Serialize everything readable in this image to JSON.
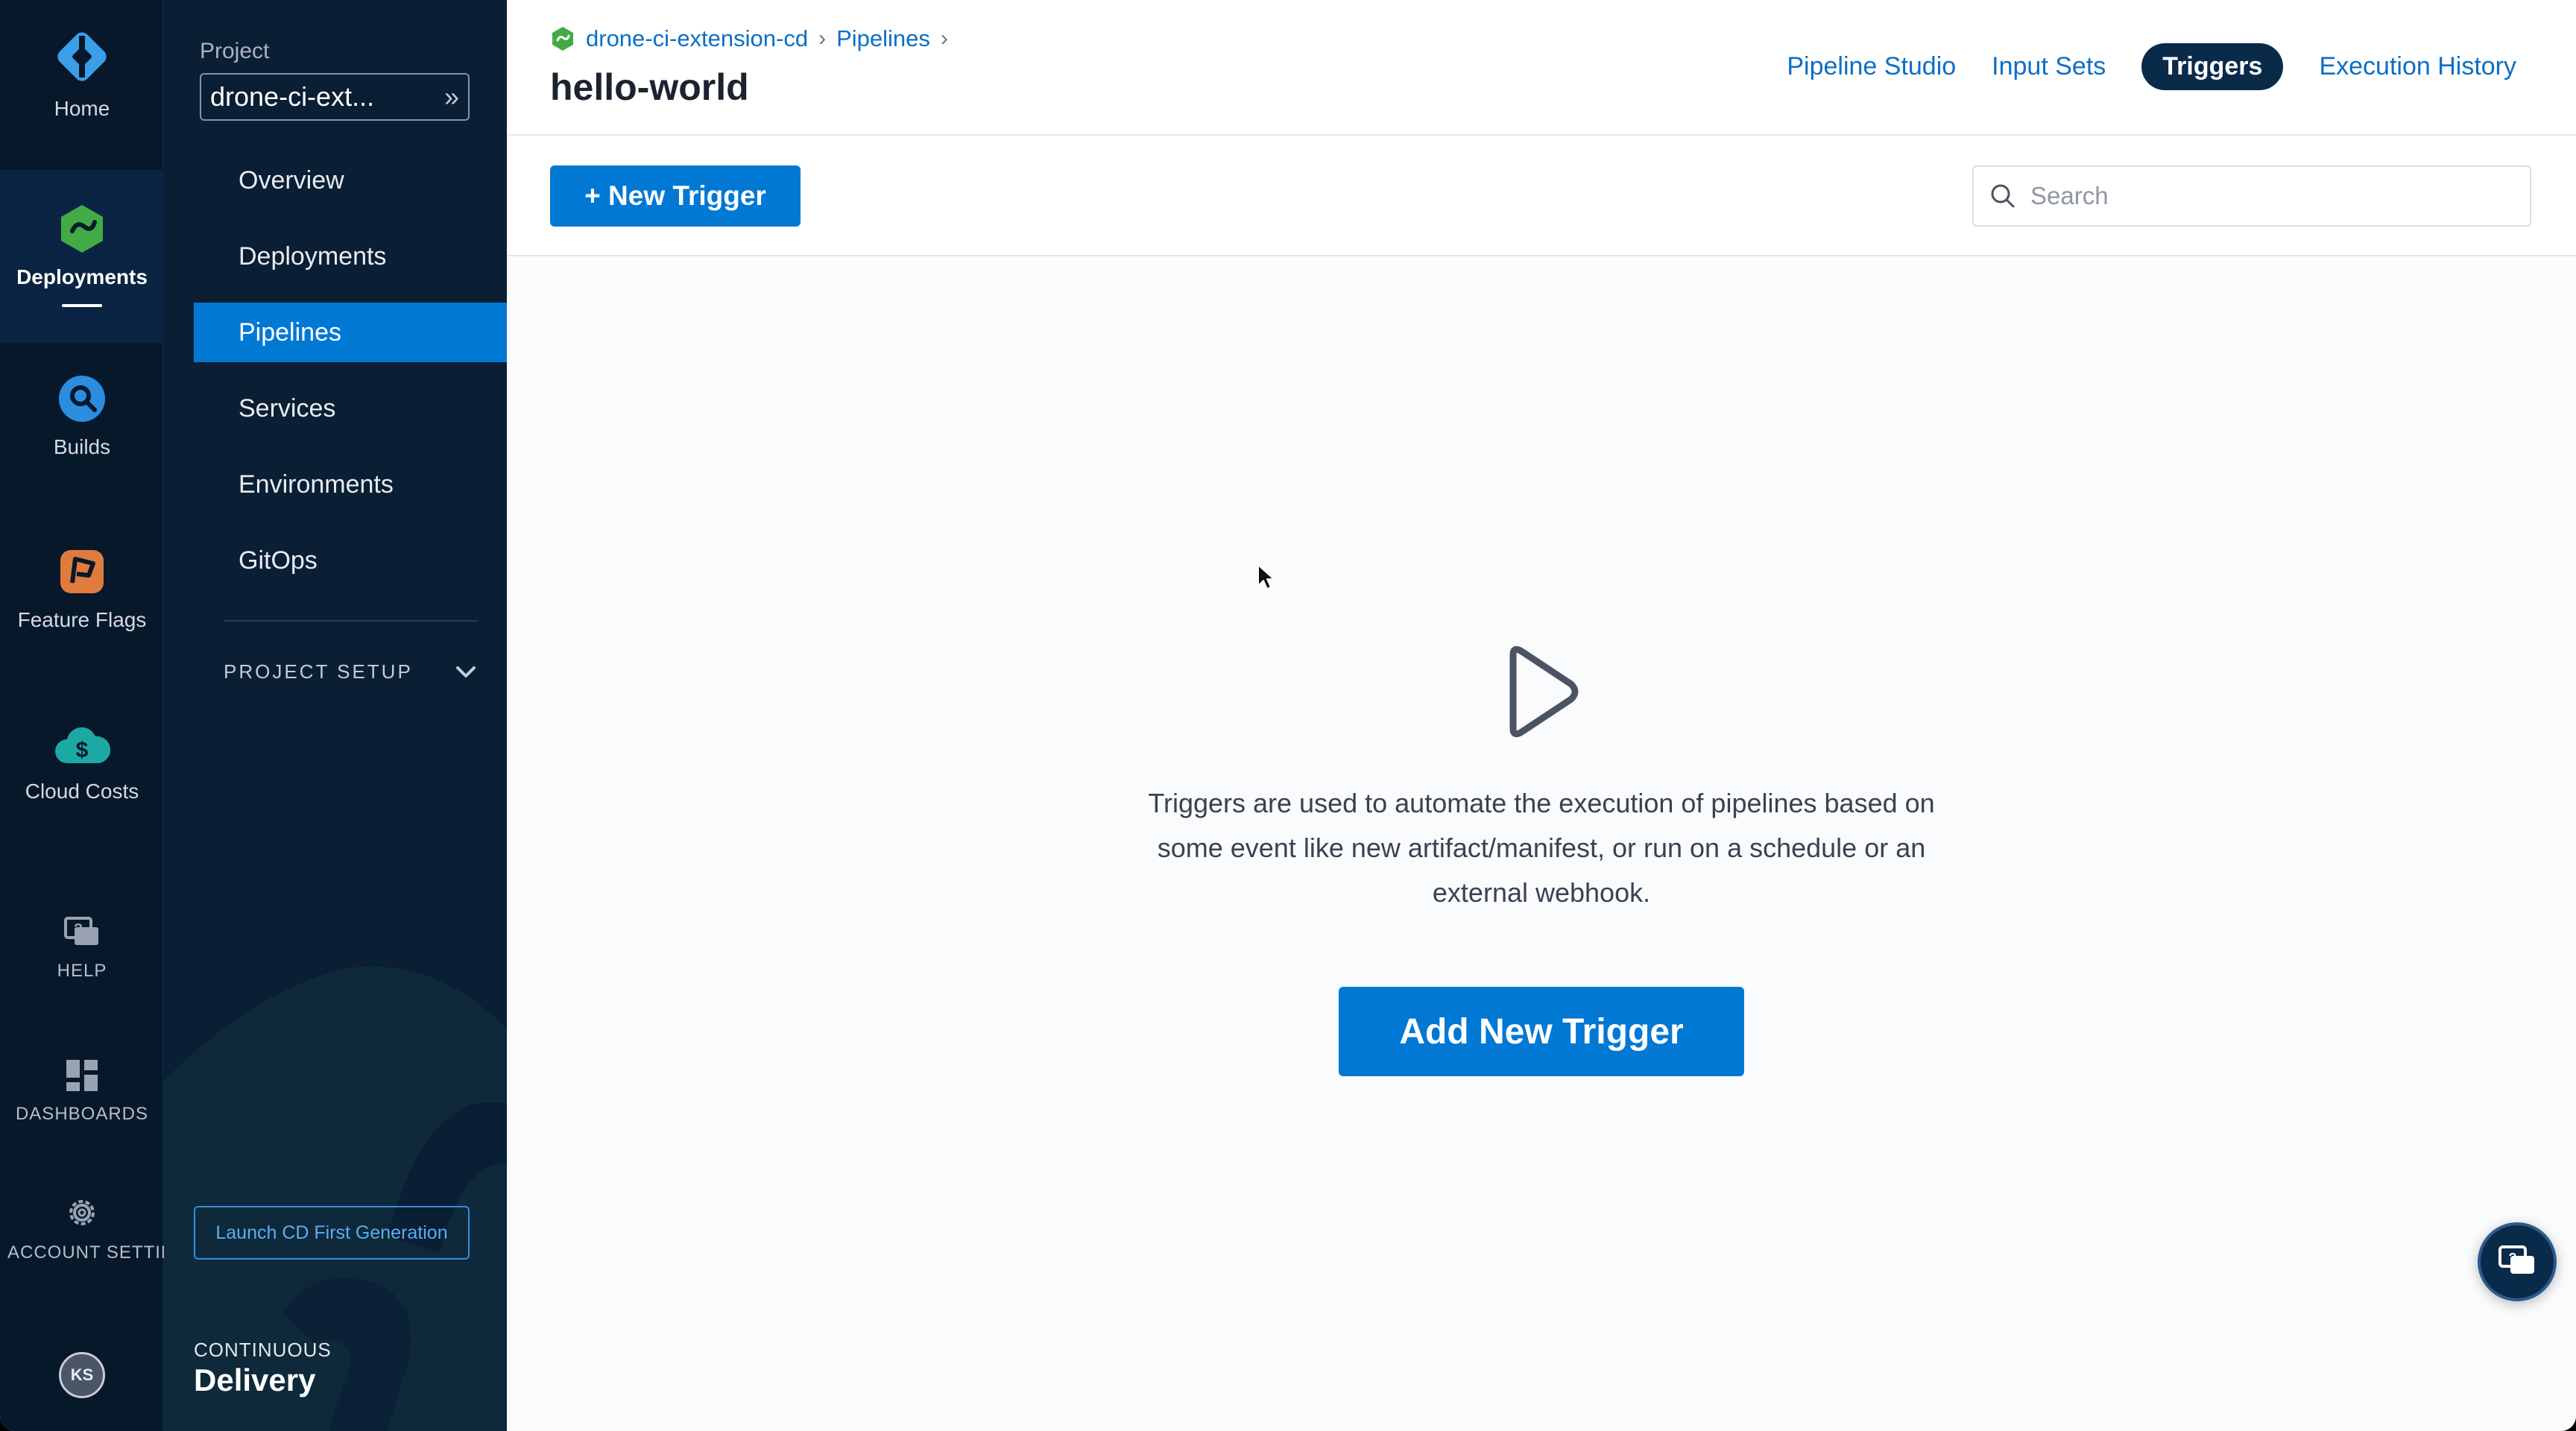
{
  "rail": {
    "home": "Home",
    "deployments": "Deployments",
    "builds": "Builds",
    "feature_flags": "Feature Flags",
    "cloud_costs": "Cloud Costs",
    "help": "HELP",
    "dashboards": "DASHBOARDS",
    "account_settings": "ACCOUNT SETTINGS",
    "avatar": "KS"
  },
  "sidebar": {
    "project_label": "Project",
    "project_name": "drone-ci-ext...",
    "items": [
      {
        "label": "Overview"
      },
      {
        "label": "Deployments"
      },
      {
        "label": "Pipelines"
      },
      {
        "label": "Services"
      },
      {
        "label": "Environments"
      },
      {
        "label": "GitOps"
      }
    ],
    "project_setup": "PROJECT SETUP",
    "launch_button": "Launch CD First Generation",
    "module_small": "CONTINUOUS",
    "module_big": "Delivery"
  },
  "header": {
    "breadcrumbs": [
      "drone-ci-extension-cd",
      "Pipelines"
    ],
    "title": "hello-world",
    "tabs": [
      {
        "label": "Pipeline Studio"
      },
      {
        "label": "Input Sets"
      },
      {
        "label": "Triggers"
      },
      {
        "label": "Execution History"
      }
    ]
  },
  "toolbar": {
    "new_trigger": "+ New Trigger",
    "search_placeholder": "Search"
  },
  "empty_state": {
    "description": "Triggers are used to automate the execution of pipelines based on some event like new artifact/manifest, or run on a schedule or an external webhook.",
    "add_button": "Add New Trigger"
  },
  "colors": {
    "accent": "#0278d5",
    "rail_bg": "#07182b",
    "sidebar_bg": "#0a1e34",
    "active_tab": "#0a2a4a"
  },
  "icons": {
    "home": "harness-logo-icon",
    "deployments": "deployments-icon",
    "builds": "builds-icon",
    "feature_flags": "feature-flags-icon",
    "cloud_costs": "cloud-costs-icon",
    "help": "help-icon",
    "dashboards": "dashboards-icon",
    "account_settings": "gear-icon",
    "empty_state": "play-icon"
  }
}
